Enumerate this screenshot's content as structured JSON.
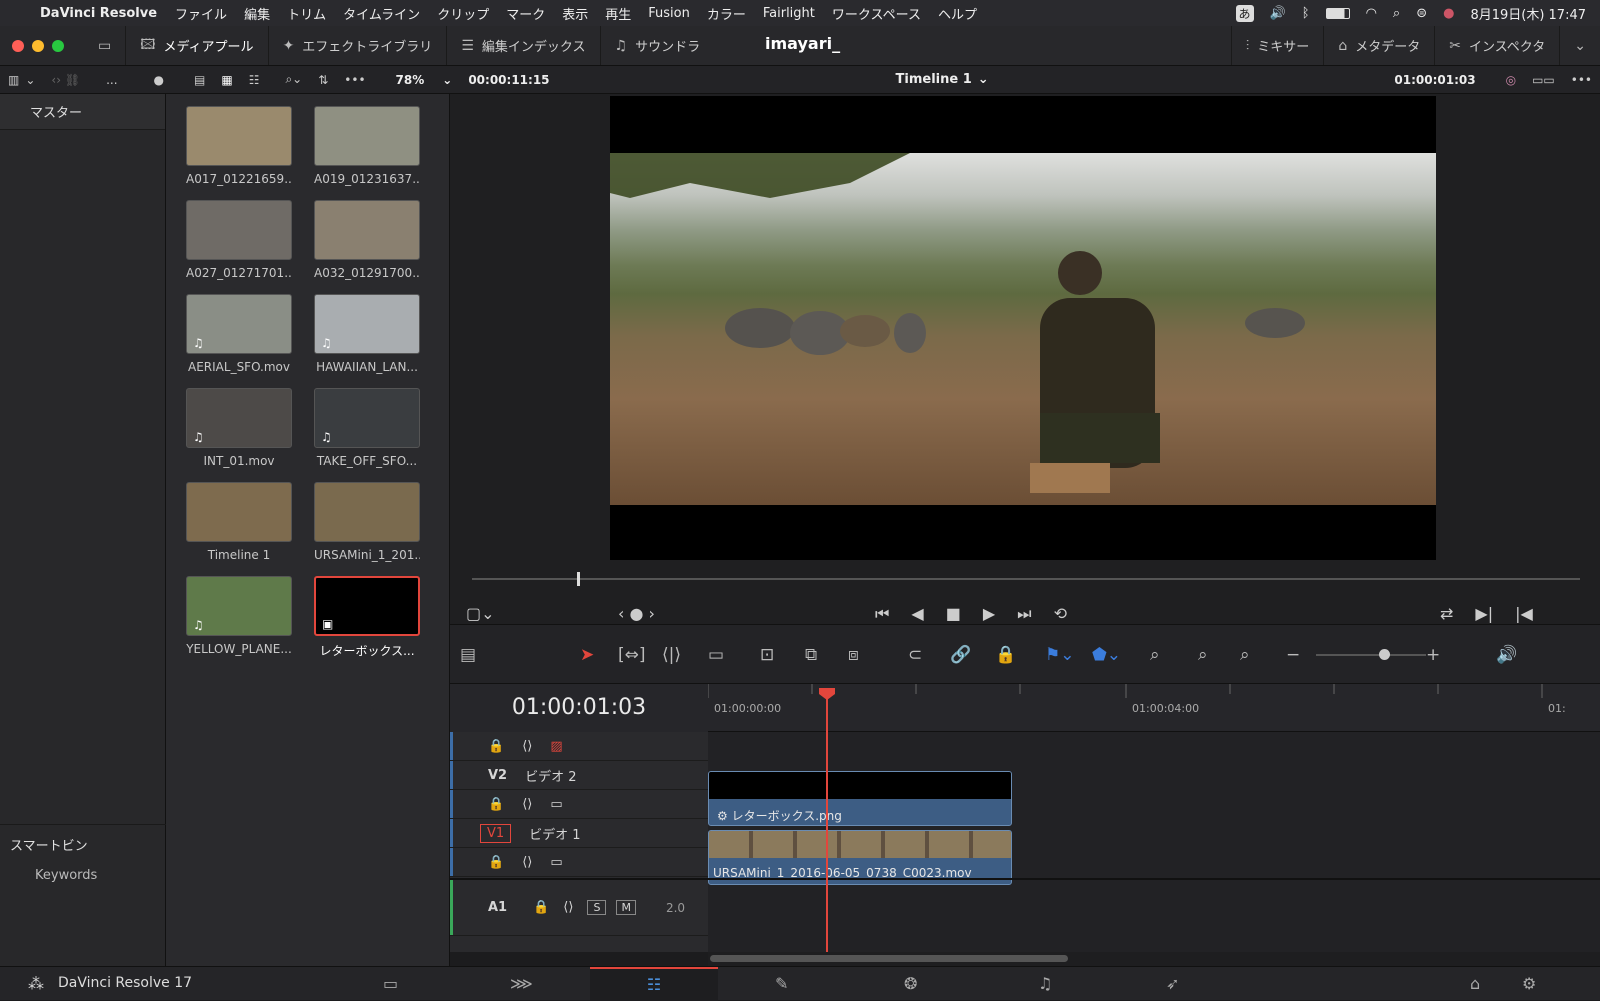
{
  "menubar": {
    "app_name": "DaVinci Resolve",
    "items": [
      "ファイル",
      "編集",
      "トリム",
      "タイムライン",
      "クリップ",
      "マーク",
      "表示",
      "再生",
      "Fusion",
      "カラー",
      "Fairlight",
      "ワークスペース",
      "ヘルプ"
    ],
    "ime": "あ",
    "datetime": "8月19日(木) 17:47"
  },
  "toolbar": {
    "media_pool": "メディアプール",
    "effects": "エフェクトライブラリ",
    "edit_index": "編集インデックス",
    "sound_library": "サウンドラ",
    "project_name": "imayari_",
    "mixer": "ミキサー",
    "metadata": "メタデータ",
    "inspector": "インスペクタ"
  },
  "subbar": {
    "more": "...",
    "zoom": "78%",
    "timecode": "00:00:11:15",
    "timeline_name": "Timeline 1",
    "timeline_tc": "01:00:01:03"
  },
  "sidebar": {
    "master": "マスター",
    "smart_bins": "スマートビン",
    "keywords": "Keywords"
  },
  "clips": [
    {
      "name": "A017_01221659...",
      "color": "#9a8a6d",
      "note": ""
    },
    {
      "name": "A019_01231637...",
      "color": "#8f9082",
      "note": ""
    },
    {
      "name": "A027_01271701...",
      "color": "#6f6b66",
      "note": ""
    },
    {
      "name": "A032_01291700...",
      "color": "#8a8070",
      "note": ""
    },
    {
      "name": "AERIAL_SFO.mov",
      "color": "#8a8e86",
      "note": "♫"
    },
    {
      "name": "HAWAIIAN_LAN...",
      "color": "#a9adb0",
      "note": "♫"
    },
    {
      "name": "INT_01.mov",
      "color": "#4d4a48",
      "note": "♫"
    },
    {
      "name": "TAKE_OFF_SFO...",
      "color": "#3a3d40",
      "note": "♫"
    },
    {
      "name": "Timeline 1",
      "color": "#7e6b4e",
      "note": ""
    },
    {
      "name": "URSAMini_1_201...",
      "color": "#7a6a4e",
      "note": ""
    },
    {
      "name": "YELLOW_PLANE...",
      "color": "#5f7a4a",
      "note": "♫"
    },
    {
      "name": "レターボックス...",
      "color": "#000000",
      "note": "▣"
    }
  ],
  "timeline": {
    "current_tc": "01:00:01:03",
    "ruler_start": "01:00:00:00",
    "ruler_mid": "01:00:04:00",
    "ruler_end": "01:",
    "v2_label": "V2",
    "v2_name": "ビデオ 2",
    "v1_label": "V1",
    "v1_name": "ビデオ 1",
    "a1_label": "A1",
    "a1_s": "S",
    "a1_m": "M",
    "a1_level": "2.0",
    "v2_clip": "レターボックス.png",
    "v1_clip": "URSAMini_1_2016-06-05_0738_C0023.mov"
  },
  "bottom": {
    "app_version": "DaVinci Resolve 17"
  },
  "colors": {
    "accent_red": "#e2463c",
    "clip_blue": "#3d5d84",
    "track_blue": "#3d6ea8"
  }
}
